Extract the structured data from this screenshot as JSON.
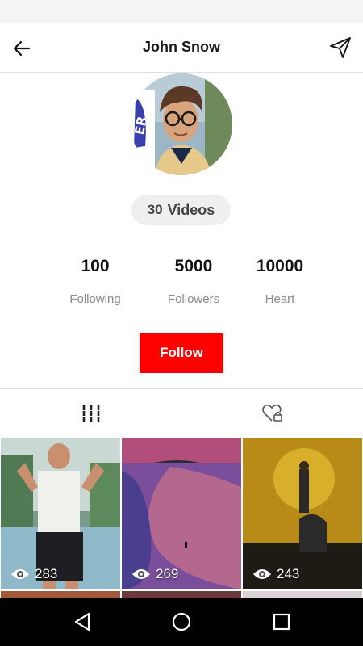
{
  "header": {
    "title": "John Snow",
    "back_icon": "arrow-left-icon",
    "share_icon": "send-icon"
  },
  "profile": {
    "video_count": "30",
    "videos_label": "Videos"
  },
  "stats": [
    {
      "value": "100",
      "label": "Following"
    },
    {
      "value": "5000",
      "label": "Followers"
    },
    {
      "value": "10000",
      "label": "Heart"
    }
  ],
  "follow_button": {
    "label": "Follow",
    "color": "#ff0000"
  },
  "tabs": [
    {
      "icon": "grid-icon",
      "active": true
    },
    {
      "icon": "liked-lock-icon",
      "active": false
    }
  ],
  "videos": [
    {
      "views": "283"
    },
    {
      "views": "269"
    },
    {
      "views": "243"
    }
  ],
  "nav": {
    "back_icon": "nav-back-icon",
    "home_icon": "nav-home-icon",
    "recents_icon": "nav-recents-icon"
  }
}
